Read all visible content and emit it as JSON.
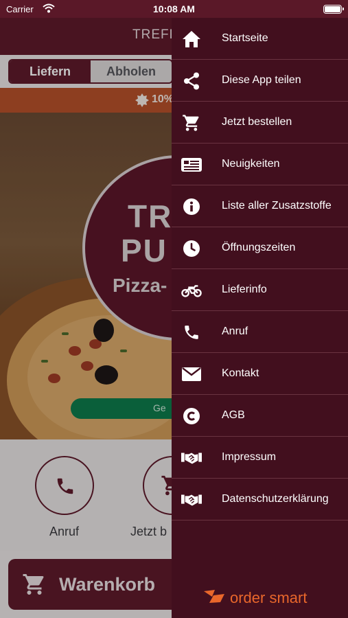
{
  "status_bar": {
    "carrier": "Carrier",
    "time": "10:08 AM"
  },
  "header": {
    "title": "TREFF"
  },
  "order_toggle": {
    "options": [
      "Liefern",
      "Abholen"
    ],
    "selected": "Liefern"
  },
  "promo": {
    "text": "10%"
  },
  "hero": {
    "logo_lines": [
      "TR",
      "PU",
      "Pizza-"
    ],
    "button_label": "Ge"
  },
  "quick_actions": [
    {
      "label": "Anruf",
      "icon": "phone-icon"
    },
    {
      "label": "Jetzt b",
      "icon": "cart-icon"
    }
  ],
  "cart": {
    "label": "Warenkorb"
  },
  "drawer": {
    "items": [
      {
        "label": "Startseite",
        "icon": "home-icon"
      },
      {
        "label": "Diese App teilen",
        "icon": "share-icon"
      },
      {
        "label": "Jetzt bestellen",
        "icon": "cart-icon"
      },
      {
        "label": "Neuigkeiten",
        "icon": "news-icon"
      },
      {
        "label": "Liste aller Zusatzstoffe",
        "icon": "info-icon"
      },
      {
        "label": "Öffnungszeiten",
        "icon": "clock-icon"
      },
      {
        "label": "Lieferinfo",
        "icon": "motorbike-icon"
      },
      {
        "label": "Anruf",
        "icon": "phone-icon"
      },
      {
        "label": "Kontakt",
        "icon": "envelope-icon"
      },
      {
        "label": "AGB",
        "icon": "copyright-icon"
      },
      {
        "label": "Impressum",
        "icon": "handshake-icon"
      },
      {
        "label": "Datenschutzerklärung",
        "icon": "handshake-icon"
      }
    ],
    "brand": {
      "text": "order smart",
      "icon": "order-smart-logo-icon"
    }
  },
  "colors": {
    "header": "#5e1a2b",
    "drawer": "#420f1e",
    "promo": "#b5502a",
    "accent_green": "#0e7a4b",
    "brand_orange": "#e9672b"
  }
}
